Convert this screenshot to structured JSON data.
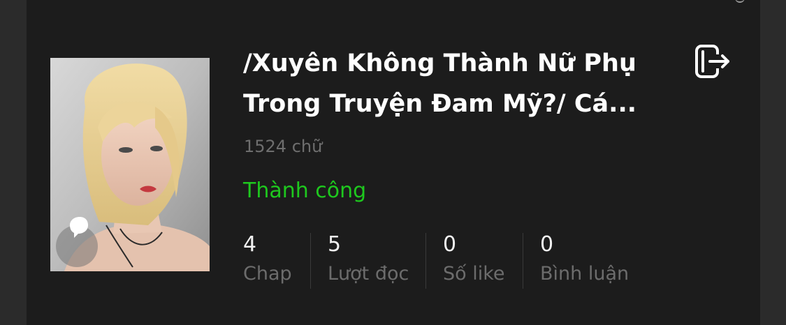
{
  "story": {
    "title": "/Xuyên Không Thành Nữ Phụ\nTrong Truyện Đam Mỹ?/ Cá...",
    "word_count": "1524 chữ",
    "status": "Thành công",
    "status_color": "#1ec81e",
    "cover_image": "portrait-of-blonde-woman",
    "actions": {
      "exit_icon": "exit-icon"
    }
  },
  "stats": [
    {
      "value": "4",
      "label": "Chap"
    },
    {
      "value": "5",
      "label": "Lượt đọc"
    },
    {
      "value": "0",
      "label": "Số like"
    },
    {
      "value": "0",
      "label": "Bình luận"
    }
  ]
}
